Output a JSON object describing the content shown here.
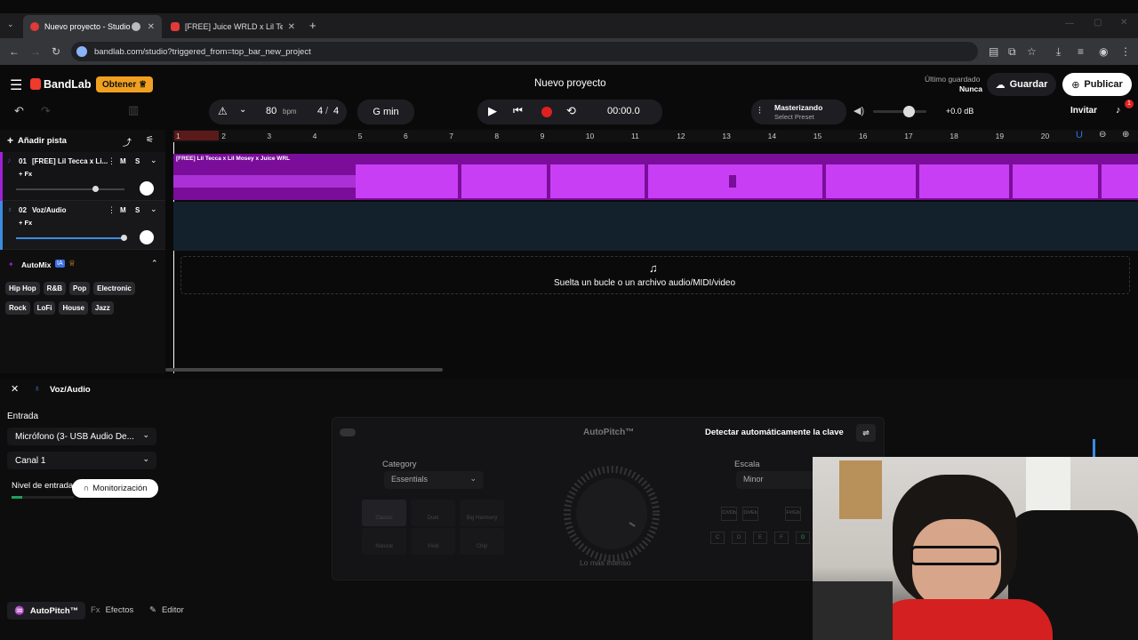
{
  "browser": {
    "tabs": [
      {
        "title": "Nuevo proyecto - Studio"
      },
      {
        "title": "[FREE] Juice WRLD x Lil Tecca Ty..."
      }
    ],
    "url": "bandlab.com/studio?triggered_from=top_bar_new_project"
  },
  "app": {
    "logo": "BandLab",
    "get_btn": "Obtener",
    "project_title": "Nuevo proyecto",
    "last_saved_label": "Último guardado",
    "last_saved_value": "Nunca",
    "save_btn": "Guardar",
    "publish_btn": "Publicar",
    "invite_btn": "Invitar",
    "notif_count": "1"
  },
  "transport": {
    "bpm": "80",
    "bpm_unit": "bpm",
    "time_sig_num": "4",
    "time_sig_sep": "/",
    "time_sig_den": "4",
    "key": "G min",
    "time": "00:00.0",
    "mastering_title": "Masterizando",
    "mastering_preset": "Select Preset",
    "volume_db": "+0.0 dB"
  },
  "tracks": {
    "add_label": "Añadir pista",
    "items": [
      {
        "number": "01",
        "name": "[FREE] Lil Tecca x Li...",
        "fx": "+ Fx",
        "mute": "M",
        "solo": "S",
        "volume": 0.73
      },
      {
        "number": "02",
        "name": "Voz/Audio",
        "fx": "+ Fx",
        "mute": "M",
        "solo": "S",
        "volume": 0.99
      }
    ]
  },
  "automix": {
    "label": "AutoMix",
    "badge": "IA",
    "genres": [
      "Hip Hop",
      "R&B",
      "Pop",
      "Electronic",
      "Rock",
      "LoFi",
      "House",
      "Jazz"
    ]
  },
  "timeline": {
    "bars": [
      "1",
      "2",
      "3",
      "4",
      "5",
      "6",
      "7",
      "8",
      "9",
      "10",
      "11",
      "12",
      "13",
      "14",
      "15",
      "16",
      "17",
      "18",
      "19",
      "20"
    ],
    "region1_label": "[FREE] Lil Tecca x Lil Mosey x Juice WRL",
    "drop_text": "Suelta un bucle o un archivo audio/MIDI/video"
  },
  "editor": {
    "track_name": "Voz/Audio",
    "input_label": "Entrada",
    "input_device": "Micrófono (3- USB Audio De...",
    "channel": "Canal 1",
    "level_label": "Nivel de entrada",
    "monitor_btn": "Monitorización",
    "autopitch": {
      "title": "AutoPitch™",
      "detect_btn": "Detectar automáticamente la clave",
      "category_label": "Category",
      "category_value": "Essentials",
      "effects": [
        "Classic",
        "Duet",
        "Big Harmony",
        "Natural",
        "Vivid",
        "Chip"
      ],
      "knob_label": "Lo más intenso",
      "scale_label": "Escala",
      "scale_value": "Minor",
      "notes_top": [
        "C#/Db",
        "D#/Eb",
        "F#/Gb"
      ],
      "notes_bottom": [
        "C",
        "D",
        "E",
        "F",
        "G"
      ]
    },
    "bottom_tabs": [
      "AutoPitch™",
      "Efectos",
      "Editor"
    ],
    "fx_prefix": "Fx"
  },
  "colors": {
    "accent_purple": "#a020d8",
    "region_dark": "#13212c",
    "record_red": "#e02020",
    "get_orange": "#f0a020"
  }
}
